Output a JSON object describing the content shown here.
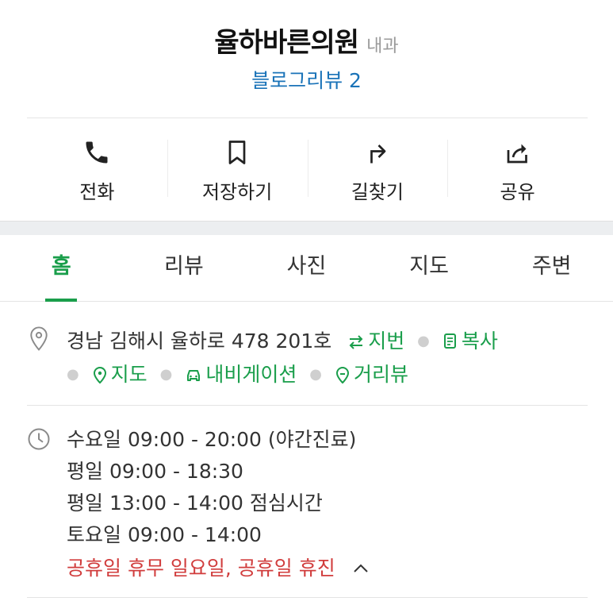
{
  "place": {
    "name": "율하바른의원",
    "category": "내과",
    "review_link": "블로그리뷰 2"
  },
  "actions": [
    {
      "label": "전화",
      "icon": "phone-icon"
    },
    {
      "label": "저장하기",
      "icon": "bookmark-icon"
    },
    {
      "label": "길찾기",
      "icon": "directions-icon"
    },
    {
      "label": "공유",
      "icon": "share-icon"
    }
  ],
  "tabs": [
    {
      "label": "홈",
      "active": true
    },
    {
      "label": "리뷰",
      "active": false
    },
    {
      "label": "사진",
      "active": false
    },
    {
      "label": "지도",
      "active": false
    },
    {
      "label": "주변",
      "active": false
    }
  ],
  "address": {
    "text": "경남 김해시 율하로 478 201호",
    "jibun_label": "지번",
    "copy_label": "복사",
    "map_label": "지도",
    "navigation_label": "내비게이션",
    "street_view_label": "거리뷰"
  },
  "hours": {
    "lines": [
      "수요일 09:00 - 20:00 (야간진료)",
      "평일 09:00 - 18:30",
      "평일 13:00 - 14:00 점심시간",
      "토요일 09:00 - 14:00"
    ],
    "holiday": "공휴일 휴무 일요일, 공휴일 휴진"
  },
  "colors": {
    "accent_green": "#1a9e4b",
    "link_blue": "#1a73b8",
    "holiday_red": "#d13d3d"
  }
}
